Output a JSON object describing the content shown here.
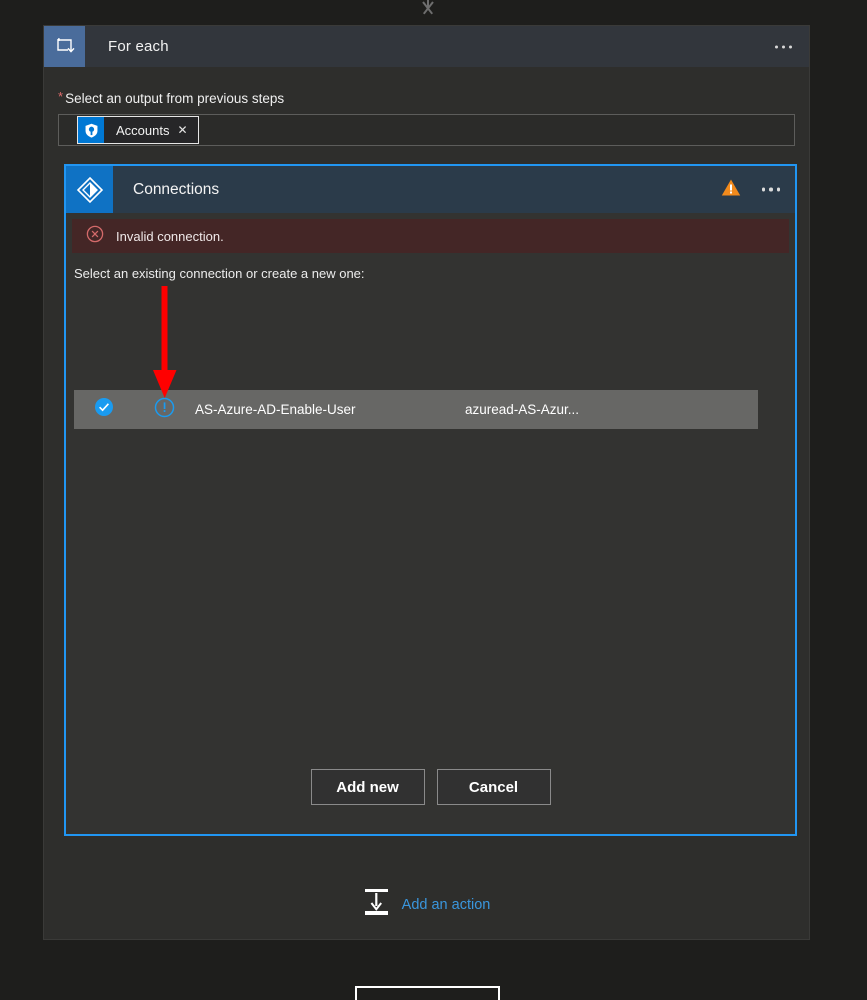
{
  "page": {
    "background_color": "#1e1e1c"
  },
  "top_connector": {
    "icon": "arrow-down-icon"
  },
  "foreach_card": {
    "icon": "loop-icon",
    "title": "For each",
    "overflow_menu": "…",
    "field": {
      "required_marker": "*",
      "label": "Select an output from previous steps",
      "token": {
        "icon": "shield-account-icon",
        "label": "Accounts",
        "remove_label": "✕"
      }
    }
  },
  "connections_card": {
    "icon": "connector-diamond-icon",
    "title": "Connections",
    "warning_icon": "warning-triangle-icon",
    "warning_color": "#f28a1c",
    "overflow_menu": "…",
    "accent_border_color": "#2196f3",
    "error": {
      "icon": "error-circle-icon",
      "text": "Invalid connection.",
      "background_color": "#442626",
      "icon_color": "#d46a6a"
    },
    "instruction": "Select an existing connection or create a new one:",
    "list": {
      "rows": [
        {
          "selected_icon": "check-circle-icon",
          "status_icon": "info-circle-icon",
          "name": "AS-Azure-AD-Enable-User",
          "reference": "azuread-AS-Azur...",
          "selected": true
        }
      ]
    },
    "buttons": {
      "add_new": "Add new",
      "cancel": "Cancel"
    }
  },
  "add_action": {
    "icon": "insert-action-icon",
    "label": "Add an action",
    "color": "#3a96dd"
  },
  "annotation": {
    "arrow": "red-down-arrow",
    "color": "#ff0000"
  },
  "bottom_stub": {
    "border_color": "#ffffff"
  }
}
